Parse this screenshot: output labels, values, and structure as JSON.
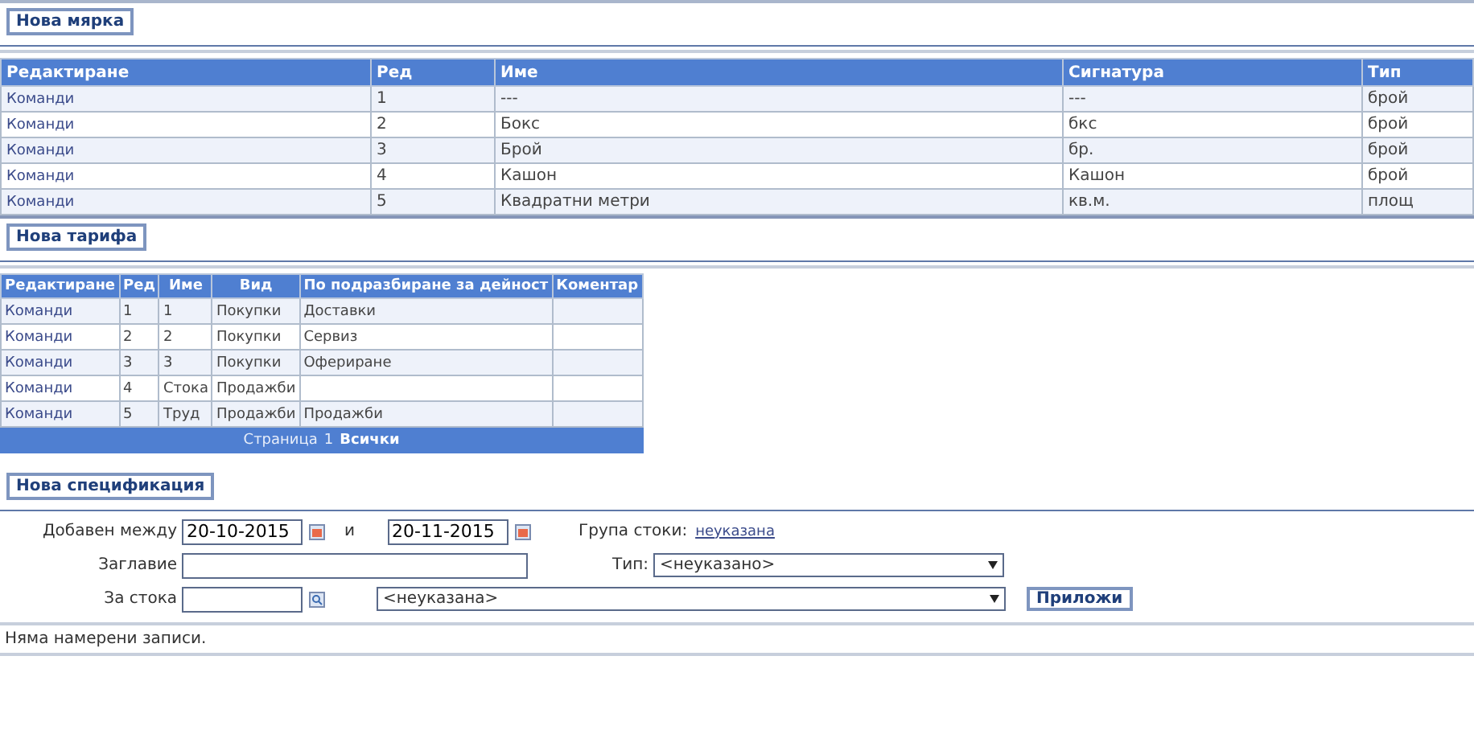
{
  "units": {
    "new_button": "Нова мярка",
    "columns": [
      "Редактиране",
      "Ред",
      "Име",
      "Сигнатура",
      "Тип"
    ],
    "rows": [
      {
        "cells": [
          "Команди",
          "1",
          "---",
          "---",
          "брой"
        ]
      },
      {
        "cells": [
          "Команди",
          "2",
          "Бокс",
          "бкс",
          "брой"
        ]
      },
      {
        "cells": [
          "Команди",
          "3",
          "Брой",
          "бр.",
          "брой"
        ]
      },
      {
        "cells": [
          "Команди",
          "4",
          "Кашон",
          "Кашон",
          "брой"
        ]
      },
      {
        "cells": [
          "Команди",
          "5",
          "Квадратни метри",
          "кв.м.",
          "площ"
        ]
      }
    ]
  },
  "tariffs": {
    "new_button": "Нова тарифа",
    "columns": [
      "Редактиране",
      "Ред",
      "Име",
      "Вид",
      "По подразбиране за дейност",
      "Коментар"
    ],
    "rows": [
      {
        "cells": [
          "Команди",
          "1",
          "1",
          "Покупки",
          "Доставки",
          ""
        ]
      },
      {
        "cells": [
          "Команди",
          "2",
          "2",
          "Покупки",
          "Сервиз",
          ""
        ]
      },
      {
        "cells": [
          "Команди",
          "3",
          "3",
          "Покупки",
          "Офериране",
          ""
        ]
      },
      {
        "cells": [
          "Команди",
          "4",
          "Стока",
          "Продажби",
          "",
          ""
        ]
      },
      {
        "cells": [
          "Команди",
          "5",
          "Труд",
          "Продажби",
          "Продажби",
          ""
        ]
      }
    ],
    "pager": {
      "label": "Страница",
      "pages": [
        {
          "label": "1",
          "selected": false
        },
        {
          "label": "Всички",
          "selected": true
        }
      ]
    }
  },
  "specifications": {
    "new_button": "Нова спецификация",
    "added_between_label": "Добавен между",
    "date_from": "20-10-2015",
    "and_label": "и",
    "date_to": "20-11-2015",
    "group_label": "Група стоки:",
    "group_value": "неуказана",
    "title_label": "Заглавие",
    "type_label": "Тип:",
    "type_select": "<неуказано>",
    "item_label": "За стока",
    "item_select": "<неуказана>",
    "apply_button": "Приложи",
    "empty_message": "Няма намерени записи."
  }
}
